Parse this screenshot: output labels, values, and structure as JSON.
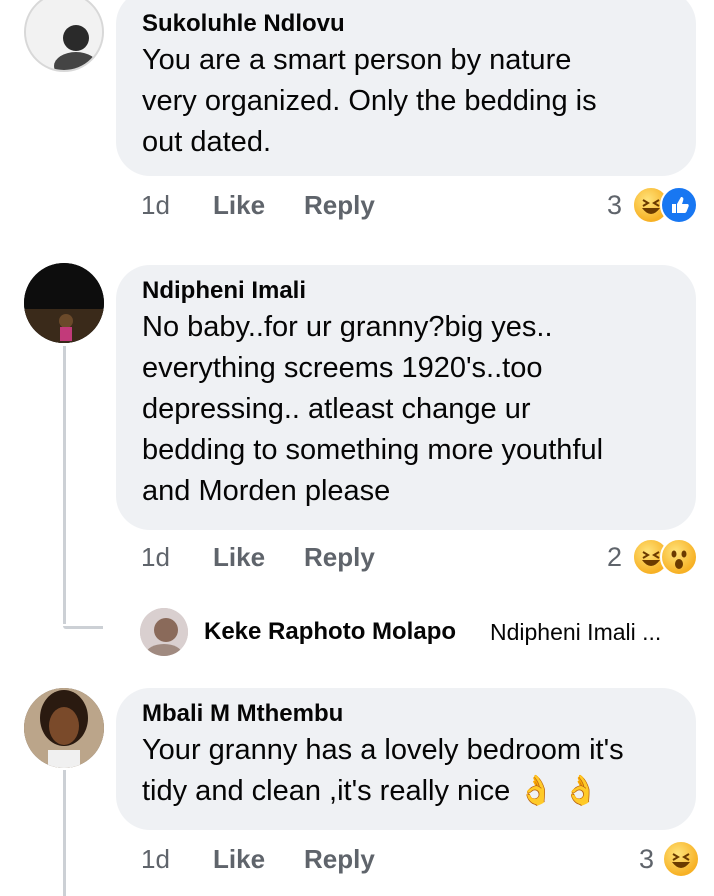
{
  "comments": [
    {
      "author": "Sukoluhle Ndlovu",
      "text": "You are a smart person by nature\nvery organized. Only the bedding is\nout dated.",
      "time": "1d",
      "like_label": "Like",
      "reply_label": "Reply",
      "reaction_count": "3",
      "reactions": [
        "haha-icon",
        "like-icon"
      ]
    },
    {
      "author": "Ndipheni Imali",
      "text": "No baby..for ur granny?big yes..\neverything screems 1920's..too\ndepressing.. atleast change ur\nbedding to something more youthful\nand Morden please",
      "time": "1d",
      "like_label": "Like",
      "reply_label": "Reply",
      "reaction_count": "2",
      "reactions": [
        "haha-icon",
        "wow-icon"
      ]
    },
    {
      "author": "Mbali M Mthembu",
      "text": "Your granny has a lovely bedroom it's\ntidy and clean ,it's really nice",
      "emoji_suffix": "👌 👌",
      "time": "1d",
      "like_label": "Like",
      "reply_label": "Reply",
      "reaction_count": "3",
      "reactions": [
        "haha-icon"
      ]
    }
  ],
  "reply_preview": {
    "author": "Keke Raphoto Molapo",
    "snippet": "Ndipheni Imali ..."
  },
  "colors": {
    "bubble": "#eff1f4",
    "meta": "#5f646b",
    "like_blue": "#1877f2",
    "emoji_yellow": "#f7b125"
  }
}
